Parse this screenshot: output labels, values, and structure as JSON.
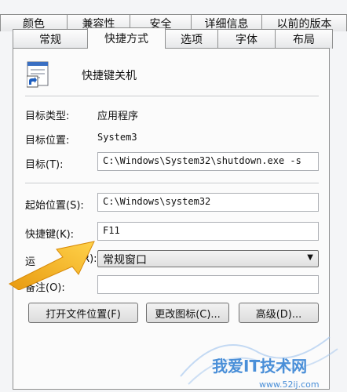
{
  "tabs_back": [
    "颜色",
    "兼容性",
    "安全",
    "详细信息",
    "以前的版本"
  ],
  "tabs_front": [
    "常规",
    "快捷方式",
    "选项",
    "字体",
    "布局"
  ],
  "header": {
    "name": "快捷键关机"
  },
  "props": {
    "target_type_label": "目标类型:",
    "target_type_value": "应用程序",
    "target_location_label": "目标位置:",
    "target_location_value": "System3",
    "target_label": "目标(T):",
    "target_value": "C:\\Windows\\System32\\shutdown.exe -s",
    "start_in_label": "起始位置(S):",
    "start_in_value": "C:\\Windows\\system32",
    "shortcut_key_label": "快捷键(K):",
    "shortcut_key_value": "F11",
    "run_label": "运",
    "run_label_tail": "(R):",
    "run_value": "常规窗口",
    "comment_label": "备注(O):",
    "comment_value": ""
  },
  "buttons": {
    "open_location": "打开文件位置(F)",
    "change_icon": "更改图标(C)...",
    "advanced": "高级(D)..."
  },
  "watermark": {
    "text": "我爱IT技术网",
    "url": "www.52ij.com"
  },
  "colors": {
    "arrow": "#f5b21a",
    "watermark": "#4a8fd8"
  }
}
